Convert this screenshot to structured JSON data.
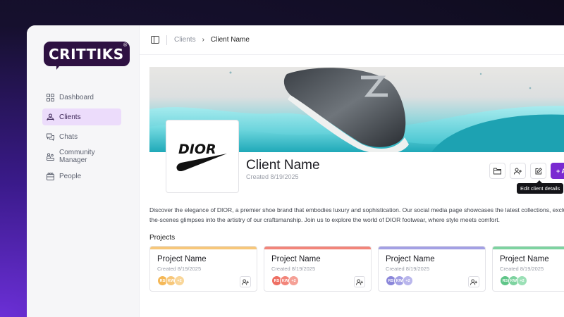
{
  "logo": {
    "text": "CRITTIKS",
    "mark": "®"
  },
  "sidebar": {
    "items": [
      {
        "label": "Dashboard",
        "icon": "dashboard-icon",
        "active": false
      },
      {
        "label": "Clients",
        "icon": "clients-icon",
        "active": true
      },
      {
        "label": "Chats",
        "icon": "chats-icon",
        "active": false
      },
      {
        "label": "Community Manager",
        "icon": "community-manager-icon",
        "active": false
      },
      {
        "label": "People",
        "icon": "people-icon",
        "active": false
      }
    ]
  },
  "breadcrumb": {
    "parent": "Clients",
    "current": "Client Name"
  },
  "client": {
    "name": "Client Name",
    "created": "Created 8/19/2025",
    "logo_text": "DIOR",
    "description_line1": "Discover the elegance of DIOR, a premier shoe brand that embodies luxury and sophistication. Our social media page showcases the latest collections, exclusive design",
    "description_line2": "the-scenes glimpses into the artistry of our craftsmanship. Join us to explore the world of DIOR footwear, where style meets comfort."
  },
  "actions": {
    "add_label": "+ A",
    "tooltip": "Edit client details"
  },
  "projects": {
    "title": "Projects",
    "items": [
      {
        "name": "Project Name",
        "created": "Created 8/19/2025",
        "color": "#f7c77a",
        "avatars": [
          "RS",
          "KW",
          "+2"
        ]
      },
      {
        "name": "Project Name",
        "created": "Created 8/19/2025",
        "color": "#f2857a",
        "avatars": [
          "RS",
          "KW",
          "+2"
        ]
      },
      {
        "name": "Project Name",
        "created": "Created 8/19/2025",
        "color": "#a3a0e4",
        "avatars": [
          "RS",
          "KW",
          "+2"
        ]
      },
      {
        "name": "Project Name",
        "created": "Created 8/19/2025",
        "color": "#7ed3a0",
        "avatars": [
          "RS",
          "KW",
          "+2"
        ]
      }
    ]
  },
  "colors": {
    "accent": "#7a2ad1",
    "active_nav_bg": "#ecdcfb",
    "logo_bg": "#2e1142"
  }
}
